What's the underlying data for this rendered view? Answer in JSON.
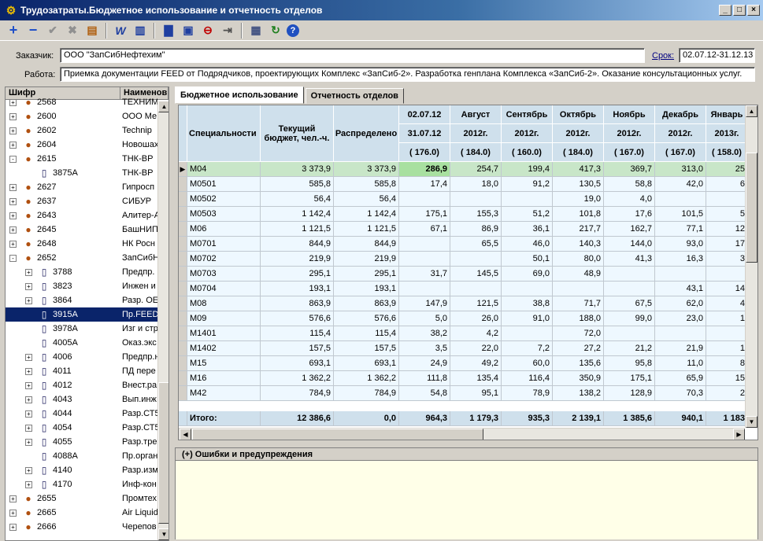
{
  "window": {
    "title": "Трудозатраты.Бюджетное использование и отчетность отделов"
  },
  "toolbar_icons": [
    "add-icon",
    "remove-icon",
    "apply-icon",
    "cancel-icon",
    "folder-icon",
    "word-icon",
    "chart-icon",
    "bar-chart-icon",
    "document-icon",
    "stop-icon",
    "arrow-icon",
    "export-icon",
    "refresh-icon",
    "help-icon"
  ],
  "header": {
    "customer_label": "Заказчик:",
    "customer_value": "ООО \"ЗапСибНефтехим\"",
    "term_label": "Срок:",
    "term_value": "02.07.12-31.12.13",
    "work_label": "Работа:",
    "work_value": "Приемка документации FEED от Подрядчиков, проектирующих Комплекс «ЗапСиб-2». Разработка генплана Комплекса «ЗапСиб-2». Оказание консультационных услуг."
  },
  "tree": {
    "col_code": "Шифр",
    "col_name": "Наименов",
    "rows": [
      {
        "code": "2568",
        "name": "ТЕХНИМ",
        "level": 0,
        "exp": "+",
        "icon": "person"
      },
      {
        "code": "2600",
        "name": "ООО Ме",
        "level": 0,
        "exp": "+",
        "icon": "person"
      },
      {
        "code": "2602",
        "name": "Technip",
        "level": 0,
        "exp": "+",
        "icon": "person"
      },
      {
        "code": "2604",
        "name": "Новошах",
        "level": 0,
        "exp": "+",
        "icon": "person"
      },
      {
        "code": "2615",
        "name": "ТНК-ВР",
        "level": 0,
        "exp": "-",
        "icon": "person"
      },
      {
        "code": "3875А",
        "name": "ТНК-ВР",
        "level": 1,
        "exp": "",
        "icon": "doc"
      },
      {
        "code": "2627",
        "name": "Гипросп",
        "level": 0,
        "exp": "+",
        "icon": "person"
      },
      {
        "code": "2637",
        "name": "СИБУР",
        "level": 0,
        "exp": "+",
        "icon": "person"
      },
      {
        "code": "2643",
        "name": "Алитер-А",
        "level": 0,
        "exp": "+",
        "icon": "person"
      },
      {
        "code": "2645",
        "name": "БашНИП",
        "level": 0,
        "exp": "+",
        "icon": "person"
      },
      {
        "code": "2648",
        "name": "НК Росн",
        "level": 0,
        "exp": "+",
        "icon": "person"
      },
      {
        "code": "2652",
        "name": "ЗапСибН",
        "level": 0,
        "exp": "-",
        "icon": "person"
      },
      {
        "code": "3788",
        "name": "Предпр.",
        "level": 1,
        "exp": "+",
        "icon": "doc"
      },
      {
        "code": "3823",
        "name": "Инжен и",
        "level": 1,
        "exp": "+",
        "icon": "doc"
      },
      {
        "code": "3864",
        "name": "Разр. ОЕ",
        "level": 1,
        "exp": "+",
        "icon": "doc"
      },
      {
        "code": "3915А",
        "name": "Пр.FEED",
        "level": 1,
        "exp": "",
        "icon": "doc",
        "selected": true
      },
      {
        "code": "3978А",
        "name": "Изг и стр",
        "level": 1,
        "exp": "",
        "icon": "doc"
      },
      {
        "code": "4005А",
        "name": "Оказ.экс",
        "level": 1,
        "exp": "",
        "icon": "doc"
      },
      {
        "code": "4006",
        "name": "Предпр.н",
        "level": 1,
        "exp": "+",
        "icon": "doc"
      },
      {
        "code": "4011",
        "name": "ПД пере",
        "level": 1,
        "exp": "+",
        "icon": "doc"
      },
      {
        "code": "4012",
        "name": "Внест.ра",
        "level": 1,
        "exp": "+",
        "icon": "doc"
      },
      {
        "code": "4043",
        "name": "Вып.инж",
        "level": 1,
        "exp": "+",
        "icon": "doc"
      },
      {
        "code": "4044",
        "name": "Разр.СТ5",
        "level": 1,
        "exp": "+",
        "icon": "doc"
      },
      {
        "code": "4054",
        "name": "Разр.СТ5",
        "level": 1,
        "exp": "+",
        "icon": "doc"
      },
      {
        "code": "4055",
        "name": "Разр.тре",
        "level": 1,
        "exp": "+",
        "icon": "doc"
      },
      {
        "code": "4088А",
        "name": "Пр.орган",
        "level": 1,
        "exp": "",
        "icon": "doc"
      },
      {
        "code": "4140",
        "name": "Разр.изм",
        "level": 1,
        "exp": "+",
        "icon": "doc"
      },
      {
        "code": "4170",
        "name": "Инф-кон",
        "level": 1,
        "exp": "+",
        "icon": "doc"
      },
      {
        "code": "2655",
        "name": "Промтех",
        "level": 0,
        "exp": "+",
        "icon": "person"
      },
      {
        "code": "2665",
        "name": "Air Liquid",
        "level": 0,
        "exp": "+",
        "icon": "person"
      },
      {
        "code": "2666",
        "name": "Черепов",
        "level": 0,
        "exp": "+",
        "icon": "person"
      }
    ]
  },
  "tabs": [
    "Бюджетное использование",
    "Отчетность отделов"
  ],
  "grid": {
    "h_spec": "Специальности",
    "h_budget": "Текущий бюджет, чел.-ч.",
    "h_dist": "Распределено",
    "months": [
      {
        "a": "02.07.12",
        "b": "31.07.12",
        "c": "( 176.0)"
      },
      {
        "a": "Август",
        "b": "2012г.",
        "c": "( 184.0)"
      },
      {
        "a": "Сентябрь",
        "b": "2012г.",
        "c": "( 160.0)"
      },
      {
        "a": "Октябрь",
        "b": "2012г.",
        "c": "( 184.0)"
      },
      {
        "a": "Ноябрь",
        "b": "2012г.",
        "c": "( 167.0)"
      },
      {
        "a": "Декабрь",
        "b": "2012г.",
        "c": "( 167.0)"
      },
      {
        "a": "Январь",
        "b": "2013г.",
        "c": "( 158.0)"
      }
    ],
    "rows": [
      {
        "s": "М04",
        "b": "3 373,9",
        "d": "3 373,9",
        "m": [
          "286,9",
          "254,7",
          "199,4",
          "417,3",
          "369,7",
          "313,0",
          "25"
        ],
        "sel": true
      },
      {
        "s": "М0501",
        "b": "585,8",
        "d": "585,8",
        "m": [
          "17,4",
          "18,0",
          "91,2",
          "130,5",
          "58,8",
          "42,0",
          "6"
        ]
      },
      {
        "s": "М0502",
        "b": "56,4",
        "d": "56,4",
        "m": [
          "",
          "",
          "",
          "19,0",
          "4,0",
          "",
          ""
        ]
      },
      {
        "s": "М0503",
        "b": "1 142,4",
        "d": "1 142,4",
        "m": [
          "175,1",
          "155,3",
          "51,2",
          "101,8",
          "17,6",
          "101,5",
          "5"
        ]
      },
      {
        "s": "М06",
        "b": "1 121,5",
        "d": "1 121,5",
        "m": [
          "67,1",
          "86,9",
          "36,1",
          "217,7",
          "162,7",
          "77,1",
          "12"
        ]
      },
      {
        "s": "М0701",
        "b": "844,9",
        "d": "844,9",
        "m": [
          "",
          "65,5",
          "46,0",
          "140,3",
          "144,0",
          "93,0",
          "17"
        ]
      },
      {
        "s": "М0702",
        "b": "219,9",
        "d": "219,9",
        "m": [
          "",
          "",
          "50,1",
          "80,0",
          "41,3",
          "16,3",
          "3"
        ]
      },
      {
        "s": "М0703",
        "b": "295,1",
        "d": "295,1",
        "m": [
          "31,7",
          "145,5",
          "69,0",
          "48,9",
          "",
          "",
          ""
        ]
      },
      {
        "s": "М0704",
        "b": "193,1",
        "d": "193,1",
        "m": [
          "",
          "",
          "",
          "",
          "",
          "43,1",
          "14"
        ]
      },
      {
        "s": "М08",
        "b": "863,9",
        "d": "863,9",
        "m": [
          "147,9",
          "121,5",
          "38,8",
          "71,7",
          "67,5",
          "62,0",
          "4"
        ]
      },
      {
        "s": "М09",
        "b": "576,6",
        "d": "576,6",
        "m": [
          "5,0",
          "26,0",
          "91,0",
          "188,0",
          "99,0",
          "23,0",
          "1"
        ]
      },
      {
        "s": "М1401",
        "b": "115,4",
        "d": "115,4",
        "m": [
          "38,2",
          "4,2",
          "",
          "72,0",
          "",
          "",
          ""
        ]
      },
      {
        "s": "М1402",
        "b": "157,5",
        "d": "157,5",
        "m": [
          "3,5",
          "22,0",
          "7,2",
          "27,2",
          "21,2",
          "21,9",
          "1"
        ]
      },
      {
        "s": "М15",
        "b": "693,1",
        "d": "693,1",
        "m": [
          "24,9",
          "49,2",
          "60,0",
          "135,6",
          "95,8",
          "11,0",
          "8"
        ]
      },
      {
        "s": "М16",
        "b": "1 362,2",
        "d": "1 362,2",
        "m": [
          "111,8",
          "135,4",
          "116,4",
          "350,9",
          "175,1",
          "65,9",
          "15"
        ]
      },
      {
        "s": "М42",
        "b": "784,9",
        "d": "784,9",
        "m": [
          "54,8",
          "95,1",
          "78,9",
          "138,2",
          "128,9",
          "70,3",
          "2"
        ]
      }
    ],
    "total": {
      "s": "Итого:",
      "b": "12 386,6",
      "d": "0,0",
      "m": [
        "964,3",
        "1 179,3",
        "935,3",
        "2 139,1",
        "1 385,6",
        "940,1",
        "1 183"
      ]
    }
  },
  "errors": {
    "title": "(+)  Ошибки и предупреждения"
  }
}
